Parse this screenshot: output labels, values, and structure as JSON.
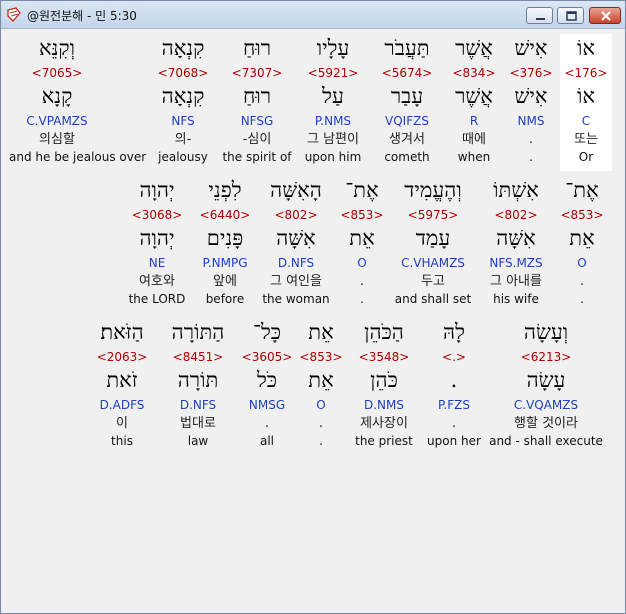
{
  "window": {
    "title": "@원전분해 - 민 5:30",
    "min_label": "minimize",
    "max_label": "maximize",
    "close_label": "close"
  },
  "rows": [
    {
      "words": [
        {
          "text": "וְקִנֵּא",
          "num": "<7065>",
          "lemma": "קָנָא",
          "morph": "C.VPAMZS",
          "kor": "의심할",
          "eng": "and he be jealous over"
        },
        {
          "text": "קִנְאָה",
          "num": "<7068>",
          "lemma": "קִנְאָה",
          "morph": "NFS",
          "kor": "의-",
          "eng": "jealousy"
        },
        {
          "text": "רוּחַ",
          "num": "<7307>",
          "lemma": "רוּחַ",
          "morph": "NFSG",
          "kor": "-심이",
          "eng": "the spirit of"
        },
        {
          "text": "עָלָיו",
          "num": "<5921>",
          "lemma": "עַל",
          "morph": "P.NMS",
          "kor": "그 남편이",
          "eng": "upon him"
        },
        {
          "text": "תַּעֲבֹר",
          "num": "<5674>",
          "lemma": "עָבַר",
          "morph": "VQIFZS",
          "kor": "생겨서",
          "eng": "cometh"
        },
        {
          "text": "אֲשֶׁר",
          "num": "<834>",
          "lemma": "אֲשֶׁר",
          "morph": "R",
          "kor": "때에",
          "eng": "when"
        },
        {
          "text": "אִישׁ",
          "num": "<376>",
          "lemma": "אִישׁ",
          "morph": "NMS",
          "kor": ".",
          "eng": "."
        },
        {
          "text": "אוֹ",
          "num": "<176>",
          "lemma": "אוֹ",
          "morph": "C",
          "kor": "또는",
          "eng": "Or"
        }
      ]
    },
    {
      "words": [
        {
          "text": "יְהוָה",
          "num": "<3068>",
          "lemma": "יְהוָה",
          "morph": "NE",
          "kor": "여호와",
          "eng": "the LORD"
        },
        {
          "text": "לִפְנֵי",
          "num": "<6440>",
          "lemma": "פָּנִים",
          "morph": "P.NMPG",
          "kor": "앞에",
          "eng": "before"
        },
        {
          "text": "הָאִשָּׁה",
          "num": "<802>",
          "lemma": "אִשָּׁה",
          "morph": "D.NFS",
          "kor": "그 여인을",
          "eng": "the woman"
        },
        {
          "text": "אֶת־",
          "num": "<853>",
          "lemma": "אֵת",
          "morph": "O",
          "kor": ".",
          "eng": "."
        },
        {
          "text": "וְהֶעֱמִיד",
          "num": "<5975>",
          "lemma": "עָמַד",
          "morph": "C.VHAMZS",
          "kor": "두고",
          "eng": "and shall set"
        },
        {
          "text": "אִשְׁתּוֹ",
          "num": "<802>",
          "lemma": "אִשָּׁה",
          "morph": "NFS.MZS",
          "kor": "그 아내를",
          "eng": "his wife"
        },
        {
          "text": "אֶת־",
          "num": "<853>",
          "lemma": "אֵת",
          "morph": "O",
          "kor": ".",
          "eng": "."
        }
      ]
    },
    {
      "words": [
        {
          "text": "הַזֹּאת׃",
          "num": "<2063>",
          "lemma": "זֹאת",
          "morph": "D.ADFS",
          "kor": "이",
          "eng": "this"
        },
        {
          "text": "הַתּוֹרָה",
          "num": "<8451>",
          "lemma": "תּוֹרָה",
          "morph": "D.NFS",
          "kor": "법대로",
          "eng": "law"
        },
        {
          "text": "כָּל־",
          "num": "<3605>",
          "lemma": "כֹּל",
          "morph": "NMSG",
          "kor": ".",
          "eng": "all"
        },
        {
          "text": "אֵת",
          "num": "<853>",
          "lemma": "אֵת",
          "morph": "O",
          "kor": ".",
          "eng": "."
        },
        {
          "text": "הַכֹּהֵן",
          "num": "<3548>",
          "lemma": "כֹּהֵן",
          "morph": "D.NMS",
          "kor": "제사장이",
          "eng": "the priest"
        },
        {
          "text": "לָהּ",
          "num": "<.>",
          "lemma": ".",
          "morph": "P.FZS",
          "kor": ".",
          "eng": "upon her"
        },
        {
          "text": "וְעָשָׂה",
          "num": "<6213>",
          "lemma": "עָשָׂה",
          "morph": "C.VQAMZS",
          "kor": "행할 것이라",
          "eng": "and - shall execute"
        }
      ]
    }
  ]
}
